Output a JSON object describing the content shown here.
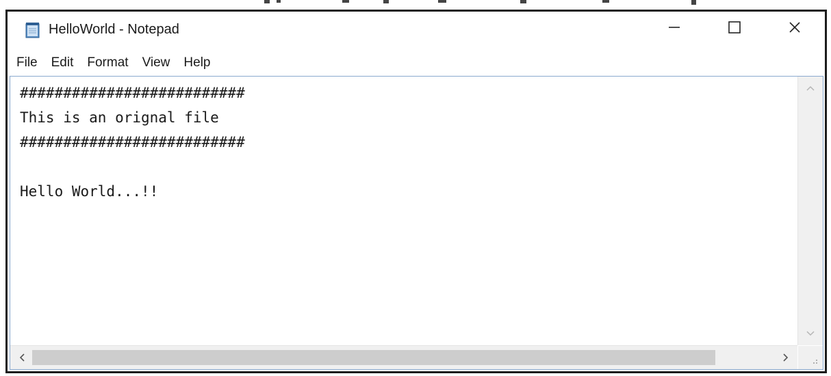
{
  "window": {
    "title": "HelloWorld - Notepad",
    "icons": {
      "app": "notepad-icon",
      "minimize": "minimize-icon",
      "maximize": "maximize-icon",
      "close": "close-icon"
    }
  },
  "menu": {
    "items": [
      {
        "label": "File"
      },
      {
        "label": "Edit"
      },
      {
        "label": "Format"
      },
      {
        "label": "View"
      },
      {
        "label": "Help"
      }
    ]
  },
  "editor": {
    "content": "##########################\nThis is an orignal file\n##########################\n\nHello World...!!"
  },
  "scrollbars": {
    "icons": {
      "up": "chevron-up-icon",
      "down": "chevron-down-icon",
      "left": "chevron-left-icon",
      "right": "chevron-right-icon",
      "grip": "size-grip-icon"
    }
  },
  "colors": {
    "frame_border": "#1c1c1c",
    "editor_border": "#8aa9cf",
    "scrollbar_bg": "#f0f0f0",
    "scroll_thumb": "#cdcdcd"
  }
}
